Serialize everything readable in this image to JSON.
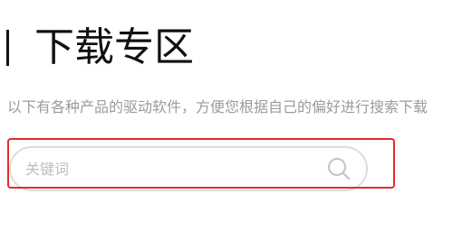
{
  "header": {
    "title": "下载专区"
  },
  "intro": {
    "text": "以下有各种产品的驱动软件，方便您根据自己的偏好进行搜索下载"
  },
  "search": {
    "placeholder": "关键词",
    "icon": "search-icon",
    "highlight_color": "#e52a2a"
  }
}
